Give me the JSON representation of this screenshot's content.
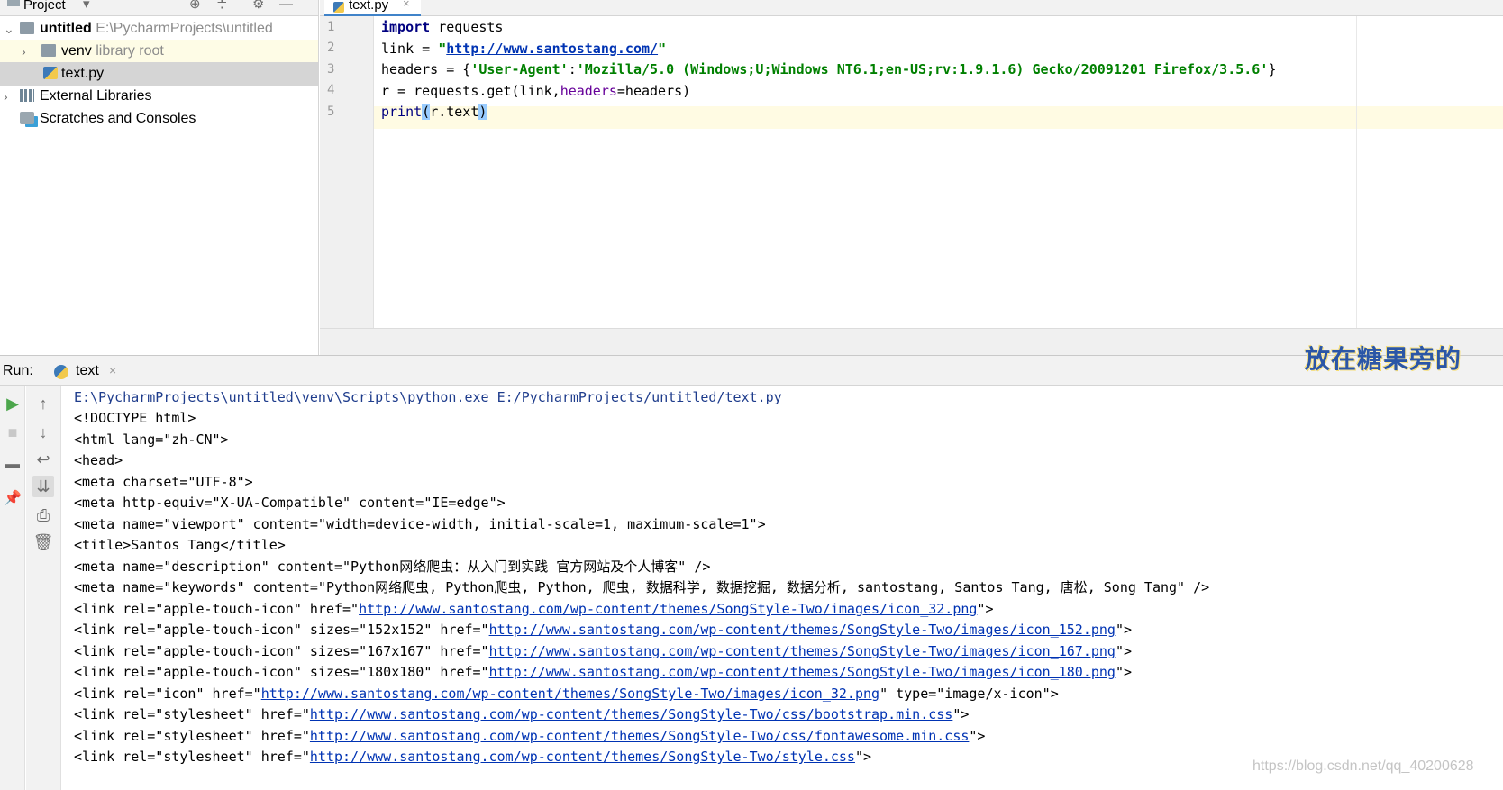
{
  "project_panel": {
    "title": "Project",
    "tree": [
      {
        "name": "untitled",
        "path": "E:\\PycharmProjects\\untitled"
      },
      {
        "name": "venv",
        "hint": "library root"
      },
      {
        "name": "text.py"
      },
      {
        "name": "External Libraries"
      },
      {
        "name": "Scratches and Consoles"
      }
    ]
  },
  "editor": {
    "tab": "text.py",
    "line_numbers": [
      "1",
      "2",
      "3",
      "4",
      "5"
    ],
    "code": {
      "l1_kw": "import",
      "l1_rest": " requests",
      "l2_pre": "link = ",
      "l2_q1": "\"",
      "l2_url": "http://www.santostang.com/",
      "l2_q2": "\"",
      "l3_pre": "headers = {",
      "l3_key": "'User-Agent'",
      "l3_colon": ":",
      "l3_val": "'Mozilla/5.0 (Windows;U;Windows NT6.1;en-US;rv:1.9.1.6) Gecko/20091201 Firefox/3.5.6'",
      "l3_end": "}",
      "l4_pre": "r = requests.get(link,",
      "l4_param": "headers",
      "l4_post": "=headers)",
      "l5_fn": "print",
      "l5_open": "(",
      "l5_mid": "r.text",
      "l5_close": ")"
    }
  },
  "run_panel": {
    "label": "Run:",
    "tab": "text",
    "overlay_text": "放在糖果旁的",
    "console": {
      "command": "E:\\PycharmProjects\\untitled\\venv\\Scripts\\python.exe E:/PycharmProjects/untitled/text.py",
      "lines_plain": [
        "<!DOCTYPE html>",
        "<html lang=\"zh-CN\">",
        "<head>",
        "<meta charset=\"UTF-8\">",
        "<meta http-equiv=\"X-UA-Compatible\" content=\"IE=edge\">",
        "<meta name=\"viewport\" content=\"width=device-width, initial-scale=1, maximum-scale=1\">",
        "<title>Santos Tang</title>",
        "<meta name=\"description\" content=\"Python网络爬虫：从入门到实践 官方网站及个人博客\" />",
        "<meta name=\"keywords\" content=\"Python网络爬虫, Python爬虫, Python, 爬虫, 数据科学, 数据挖掘, 数据分析, santostang, Santos Tang, 唐松, Song Tang\" />"
      ],
      "link_lines": [
        {
          "pre": "<link rel=\"apple-touch-icon\" href=\"",
          "url": "http://www.santostang.com/wp-content/themes/SongStyle-Two/images/icon_32.png",
          "post": "\">"
        },
        {
          "pre": "<link rel=\"apple-touch-icon\" sizes=\"152x152\" href=\"",
          "url": "http://www.santostang.com/wp-content/themes/SongStyle-Two/images/icon_152.png",
          "post": "\">"
        },
        {
          "pre": "<link rel=\"apple-touch-icon\" sizes=\"167x167\" href=\"",
          "url": "http://www.santostang.com/wp-content/themes/SongStyle-Two/images/icon_167.png",
          "post": "\">"
        },
        {
          "pre": "<link rel=\"apple-touch-icon\" sizes=\"180x180\" href=\"",
          "url": "http://www.santostang.com/wp-content/themes/SongStyle-Two/images/icon_180.png",
          "post": "\">"
        },
        {
          "pre": "<link rel=\"icon\" href=\"",
          "url": "http://www.santostang.com/wp-content/themes/SongStyle-Two/images/icon_32.png",
          "post": "\" type=\"image/x-icon\">"
        },
        {
          "pre": "<link rel=\"stylesheet\" href=\"",
          "url": "http://www.santostang.com/wp-content/themes/SongStyle-Two/css/bootstrap.min.css",
          "post": "\">"
        },
        {
          "pre": "<link rel=\"stylesheet\" href=\"",
          "url": "http://www.santostang.com/wp-content/themes/SongStyle-Two/css/fontawesome.min.css",
          "post": "\">"
        },
        {
          "pre": "<link rel=\"stylesheet\" href=\"",
          "url": "http://www.santostang.com/wp-content/themes/SongStyle-Two/style.css",
          "post": "\">"
        }
      ]
    },
    "watermark": "https://blog.csdn.net/qq_40200628"
  },
  "colors": {
    "keyword": "#000080",
    "string": "#008000",
    "link": "#0033b3",
    "current_line": "#fffbe3"
  }
}
